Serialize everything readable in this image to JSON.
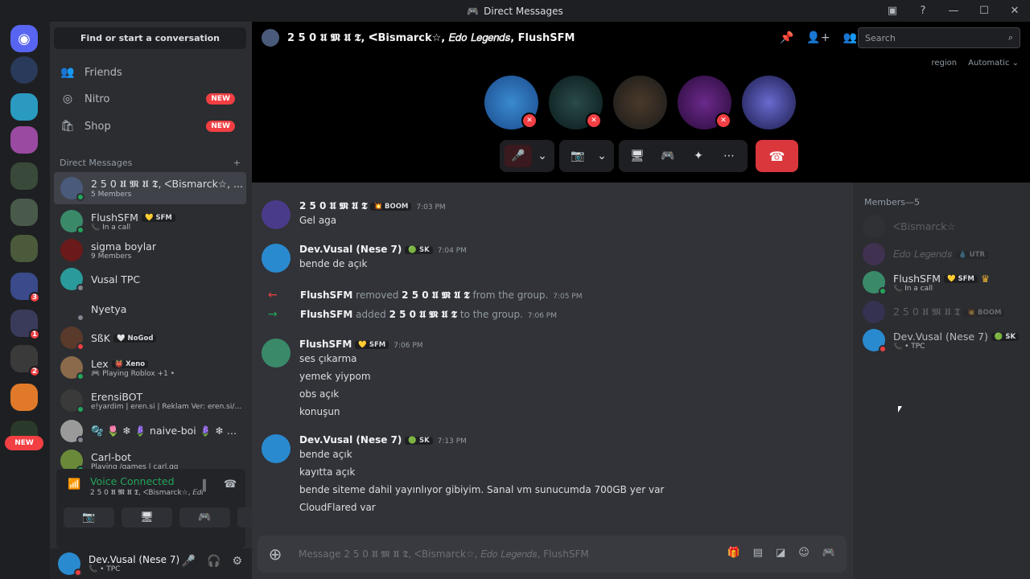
{
  "window": {
    "title": "Direct Messages"
  },
  "dm_panel": {
    "search_label": "Find or start a conversation",
    "nav": [
      {
        "label": "Friends",
        "icon": "friends-icon"
      },
      {
        "label": "Nitro",
        "icon": "nitro-icon",
        "badge": "NEW"
      },
      {
        "label": "Shop",
        "icon": "shop-icon",
        "badge": "NEW"
      }
    ],
    "dm_header": "Direct Messages",
    "dms": [
      {
        "name": "2 5 0 𝖀 𝕸 𝖀 𝕿, ᐸBismarck☆, ...",
        "sub": "5 Members",
        "status": "on",
        "color": "#4a5a7a"
      },
      {
        "name": "FlushSFM",
        "tag": "💛 SFM",
        "sub": "📞 In a call",
        "status": "on",
        "color": "#3a8a6a"
      },
      {
        "name": "sigma boylar",
        "sub": "9 Members",
        "status": "",
        "color": "#6a1a1a"
      },
      {
        "name": "Vusal TPC",
        "sub": "",
        "status": "off",
        "color": "#2a9a9a"
      },
      {
        "name": "Nyetya",
        "sub": "",
        "status": "off",
        "color": "#2b2d31"
      },
      {
        "name": "SßK",
        "tag": "🤍 NoGod",
        "sub": "",
        "status": "dnd",
        "color": "#5a3a2a"
      },
      {
        "name": "Lex",
        "tag": "👹 Xeno",
        "sub": "🎮 Playing Roblox +1 •",
        "status": "on",
        "color": "#8a6a4a"
      },
      {
        "name": "ErensiBOT",
        "sub": "e!yardim | eren.si | Reklam Ver: eren.si/ads",
        "status": "on",
        "color": "#3a3a3a"
      },
      {
        "name": "🫧 🌷 ❄ 🪻 naive-boi 🪻 ❄ 🌷 ...",
        "sub": "",
        "status": "off",
        "color": "#9a9a9a"
      },
      {
        "name": "Carl-bot",
        "sub": "Playing /games | carl.gg",
        "status": "on",
        "color": "#6a8a3a"
      }
    ],
    "voice": {
      "status": "Voice Connected",
      "channel": "2 5 0 𝖀 𝕸 𝖀 𝕿, ᐸBismarck☆, 𝐸𝑑𝑜 𝐿𝑒𝑔𝑒..."
    },
    "user": {
      "name": "Dev.Vusal (Nese 7)",
      "sub": "📞 • TPC"
    }
  },
  "chat": {
    "title": "2 5 0 𝖀 𝕸 𝖀 𝕿, ᐸBismarck☆, 𝐸𝑑𝑜 𝐿𝑒𝑔𝑒𝑛𝑑𝑠, FlushSFM",
    "search_placeholder": "Search",
    "region_label": "region",
    "region_value": "Automatic ⌄",
    "placeholder": "Message 2 5 0 𝖀 𝕸 𝖀 𝕿, ᐸBismarck☆, 𝐸𝑑𝑜 𝐿𝑒𝑔𝑒𝑛𝑑𝑠, FlushSFM",
    "messages": [
      {
        "author": "2 5 0 𝖀 𝕸 𝖀 𝕿",
        "tag": "💥 BOOM",
        "time": "7:03 PM",
        "lines": [
          "Gel aga"
        ]
      },
      {
        "author": "Dev.Vusal (Nese 7)",
        "tag": "🟢 SK",
        "time": "7:04 PM",
        "lines": [
          "bende de açık"
        ]
      },
      {
        "author": "FlushSFM",
        "tag": "💛 SFM",
        "time": "7:06 PM",
        "lines": [
          "ses çıkarma",
          "yemek yiypom",
          "obs açık",
          "konuşun"
        ]
      },
      {
        "author": "Dev.Vusal (Nese 7)",
        "tag": "🟢 SK",
        "time": "7:13 PM",
        "lines": [
          "bende açık",
          "kayıtta açık",
          "bende siteme dahil yayınlıyor gibiyim. Sanal vm sunucumda 700GB yer var",
          "CloudFlared var"
        ]
      }
    ],
    "system": [
      {
        "actor": "FlushSFM",
        "action": "removed",
        "target": "2 5 0 𝖀 𝕸 𝖀 𝕿",
        "suffix": "from the group.",
        "time": "7:05 PM"
      },
      {
        "actor": "FlushSFM",
        "action": "added",
        "target": "2 5 0 𝖀 𝕸 𝖀 𝕿",
        "suffix": "to the group.",
        "time": "7:06 PM"
      }
    ]
  },
  "members": {
    "header": "Members—5",
    "list": [
      {
        "name": "ᐸBismarck☆",
        "tag": "",
        "sub": ""
      },
      {
        "name": "𝐸𝑑𝑜 𝐿𝑒𝑔𝑒𝑛𝑑𝑠",
        "tag": "💧 UTR",
        "sub": ""
      },
      {
        "name": "FlushSFM",
        "tag": "💛 SFM",
        "sub": "📞 In a call"
      },
      {
        "name": "2 5 0 𝖀 𝕸 𝖀 𝕿",
        "tag": "💥 BOOM",
        "sub": ""
      },
      {
        "name": "Dev.Vusal (Nese 7)",
        "tag": "🟢 SK",
        "sub": "📞 • TPC"
      }
    ]
  },
  "colors": {
    "accent": "#5865f2",
    "green": "#23a55a",
    "red": "#f23f43"
  }
}
